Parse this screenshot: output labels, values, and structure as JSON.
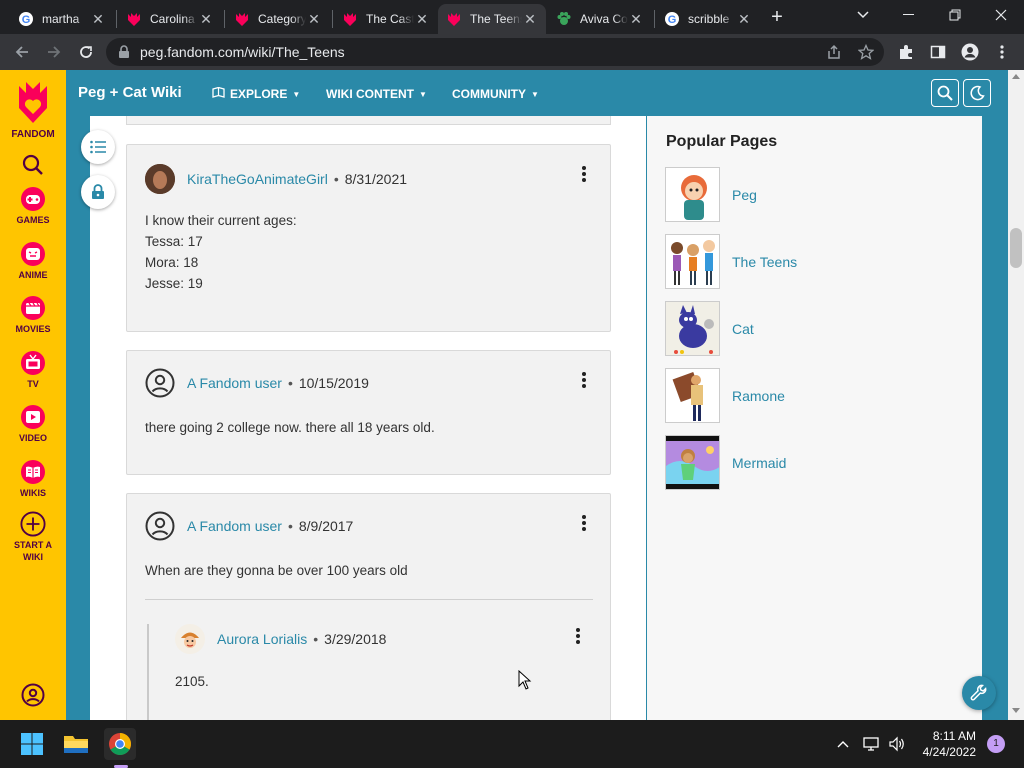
{
  "browser": {
    "tabs": [
      {
        "title": "martha",
        "favicon": "google-icon"
      },
      {
        "title": "Carolina",
        "favicon": "fandom-icon"
      },
      {
        "title": "Category",
        "favicon": "fandom-icon"
      },
      {
        "title": "The Cast",
        "favicon": "fandom-icon"
      },
      {
        "title": "The Teens",
        "favicon": "fandom-icon",
        "active": true
      },
      {
        "title": "Aviva Co",
        "favicon": "paw-icon"
      },
      {
        "title": "scribble",
        "favicon": "google-icon"
      }
    ],
    "url": "peg.fandom.com/wiki/The_Teens"
  },
  "rail": {
    "brand": "FANDOM",
    "items": [
      {
        "label": "GAMES",
        "icon": "gamepad-icon"
      },
      {
        "label": "ANIME",
        "icon": "anime-icon"
      },
      {
        "label": "MOVIES",
        "icon": "movie-icon"
      },
      {
        "label": "TV",
        "icon": "tv-icon"
      },
      {
        "label": "VIDEO",
        "icon": "video-icon"
      },
      {
        "label": "WIKIS",
        "icon": "book-icon"
      }
    ],
    "start_line1": "START A",
    "start_line2": "WIKI"
  },
  "wiki": {
    "name": "Peg + Cat Wiki",
    "nav": [
      "EXPLORE",
      "WIKI CONTENT",
      "COMMUNITY"
    ]
  },
  "comments": [
    {
      "user": "KiraTheGoAnimateGirl",
      "date": "8/31/2021",
      "lines": [
        "I know their current ages:",
        "Tessa: 17",
        "Mora: 18",
        "Jesse: 19"
      ]
    },
    {
      "user": "A Fandom user",
      "date": "10/15/2019",
      "lines": [
        "there going 2 college now. there all 18 years old."
      ]
    },
    {
      "user": "A Fandom user",
      "date": "8/9/2017",
      "lines": [
        "When are they gonna be over 100 years old"
      ],
      "reply": {
        "user": "Aurora Lorialis",
        "date": "3/29/2018",
        "text": "2105."
      }
    }
  ],
  "sidebar": {
    "title": "Popular Pages",
    "pages": [
      "Peg",
      "The Teens",
      "Cat",
      "Ramone",
      "Mermaid"
    ]
  },
  "taskbar": {
    "time": "8:11 AM",
    "date": "4/24/2022",
    "notifications": "1"
  },
  "colors": {
    "fandom_yellow": "#ffc500",
    "wiki_teal": "#2a89a8",
    "fandom_plum": "#520044"
  }
}
